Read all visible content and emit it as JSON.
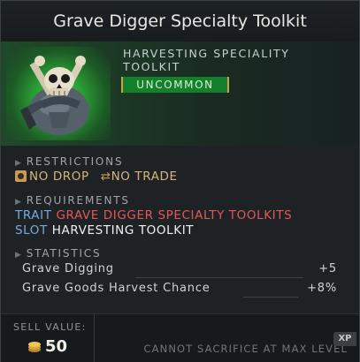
{
  "item": {
    "name": "Grave Digger Specialty Toolkit",
    "subtitle": "HARVESTING SPECIALITY TOOLKIT",
    "rarity": "UNCOMMON",
    "rarity_color": "#14802b",
    "icon": "skull-sack-icon"
  },
  "restrictions": {
    "header": "RESTRICTIONS",
    "no_drop": "NO DROP",
    "no_trade": "NO TRADE"
  },
  "requirements": {
    "header": "REQUIREMENTS",
    "trait_label": "TRAIT",
    "trait_value": "GRAVE DIGGER SPECIALTY TOOLKITS",
    "slot_label": "SLOT",
    "slot_value": "HARVESTING TOOLKIT"
  },
  "statistics": {
    "header": "STATISTICS",
    "rows": [
      {
        "label": "Grave Digging",
        "value": "+5"
      },
      {
        "label": "Grave Goods Harvest Chance",
        "value": "+8%"
      }
    ]
  },
  "footer": {
    "sell_label": "SELL VALUE:",
    "sell_value": "50",
    "cannot": "CANNOT SACRIFICE AT MAX LEVEL",
    "xp": "XP"
  }
}
